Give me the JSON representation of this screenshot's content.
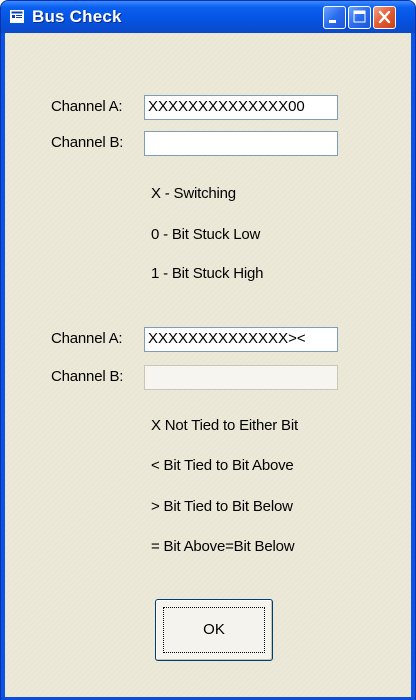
{
  "window": {
    "title": "Bus Check",
    "colors": {
      "titlebar": "#0553e1",
      "client": "#ece9d8",
      "close_button": "#e45a32"
    },
    "icons": {
      "app": "app-window-icon",
      "minimize": "minimize-icon",
      "maximize": "maximize-icon",
      "close": "close-icon"
    }
  },
  "group1": {
    "channel_a_label": "Channel A:",
    "channel_a_value": "XXXXXXXXXXXXXX00",
    "channel_b_label": "Channel B:",
    "channel_b_value": "",
    "legend": [
      "X - Switching",
      "0 - Bit Stuck Low",
      "1 - Bit Stuck High"
    ]
  },
  "group2": {
    "channel_a_label": "Channel A:",
    "channel_a_value": "XXXXXXXXXXXXXX><",
    "channel_b_label": "Channel B:",
    "channel_b_value": "",
    "legend": [
      "X  Not Tied to Either Bit",
      "<  Bit Tied to Bit Above",
      ">  Bit Tied to Bit Below",
      "=  Bit Above=Bit Below"
    ]
  },
  "buttons": {
    "ok_label": "OK"
  }
}
